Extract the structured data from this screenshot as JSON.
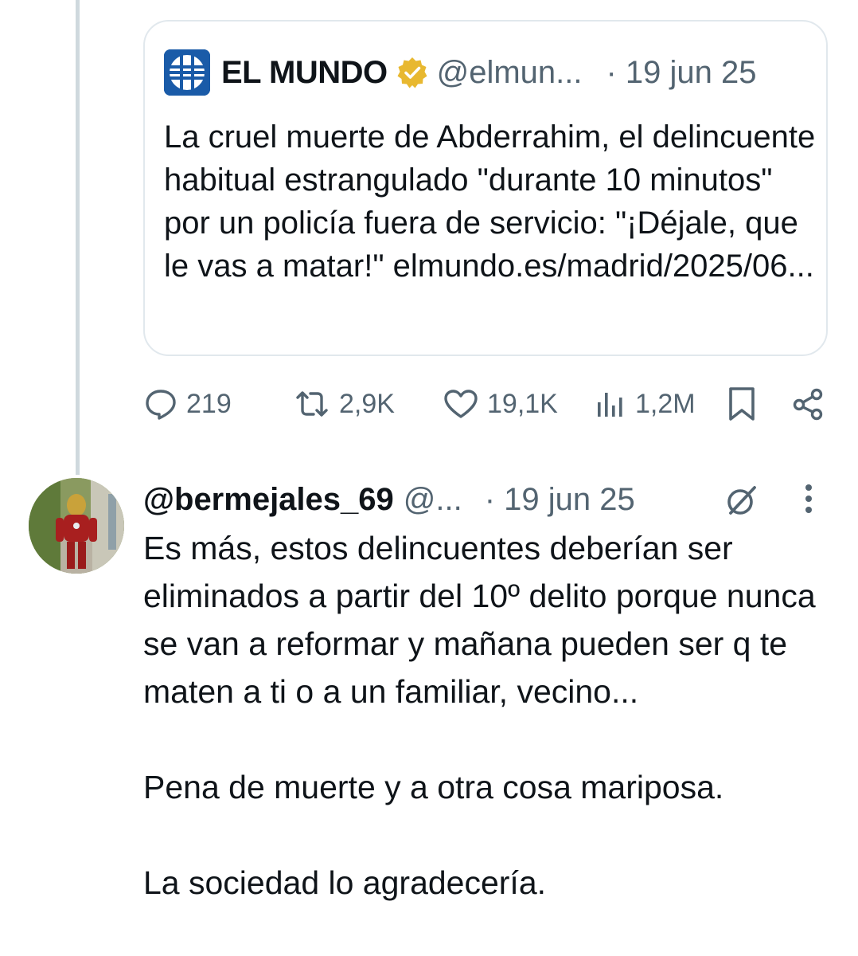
{
  "quoted_tweet": {
    "author_name": "EL MUNDO",
    "handle": "@elmun...",
    "date": "· 19 jun 25",
    "text": "La cruel muerte de Abderrahim, el delincuente habitual estrangulado \"durante 10 minutos\" por un policía fuera de servicio: \"¡Déjale, que le vas a matar!\" elmundo.es/madrid/2025/06...",
    "icons": {
      "logo": "el-mundo-logo",
      "verified": "verified-badge-gold"
    }
  },
  "actions": {
    "replies": "219",
    "reposts": "2,9K",
    "likes": "19,1K",
    "views": "1,2M",
    "icons": [
      "reply-icon",
      "repost-icon",
      "like-icon",
      "views-icon",
      "bookmark-icon",
      "share-icon"
    ]
  },
  "reply_tweet": {
    "author_name": "@bermejales_69",
    "handle": "@...",
    "date": "· 19 jun 25",
    "paragraphs": [
      "Es más, estos delincuentes deberían ser eliminados a partir del 10º delito porque nunca se van a reformar y mañana pueden ser q te maten a ti o a un familiar, vecino...",
      "Pena de muerte y a otra cosa mariposa.",
      "La sociedad lo agradecería."
    ],
    "icons": {
      "avatar": "avatar-image",
      "grok": "grok-icon",
      "more": "more-icon"
    }
  },
  "colors": {
    "text": "#0f1419",
    "muted": "#536471",
    "border": "#e1e8ed",
    "thread_line": "#cfd9de",
    "logo_blue": "#1a5ba8",
    "verified_gold": "#e8b830"
  }
}
